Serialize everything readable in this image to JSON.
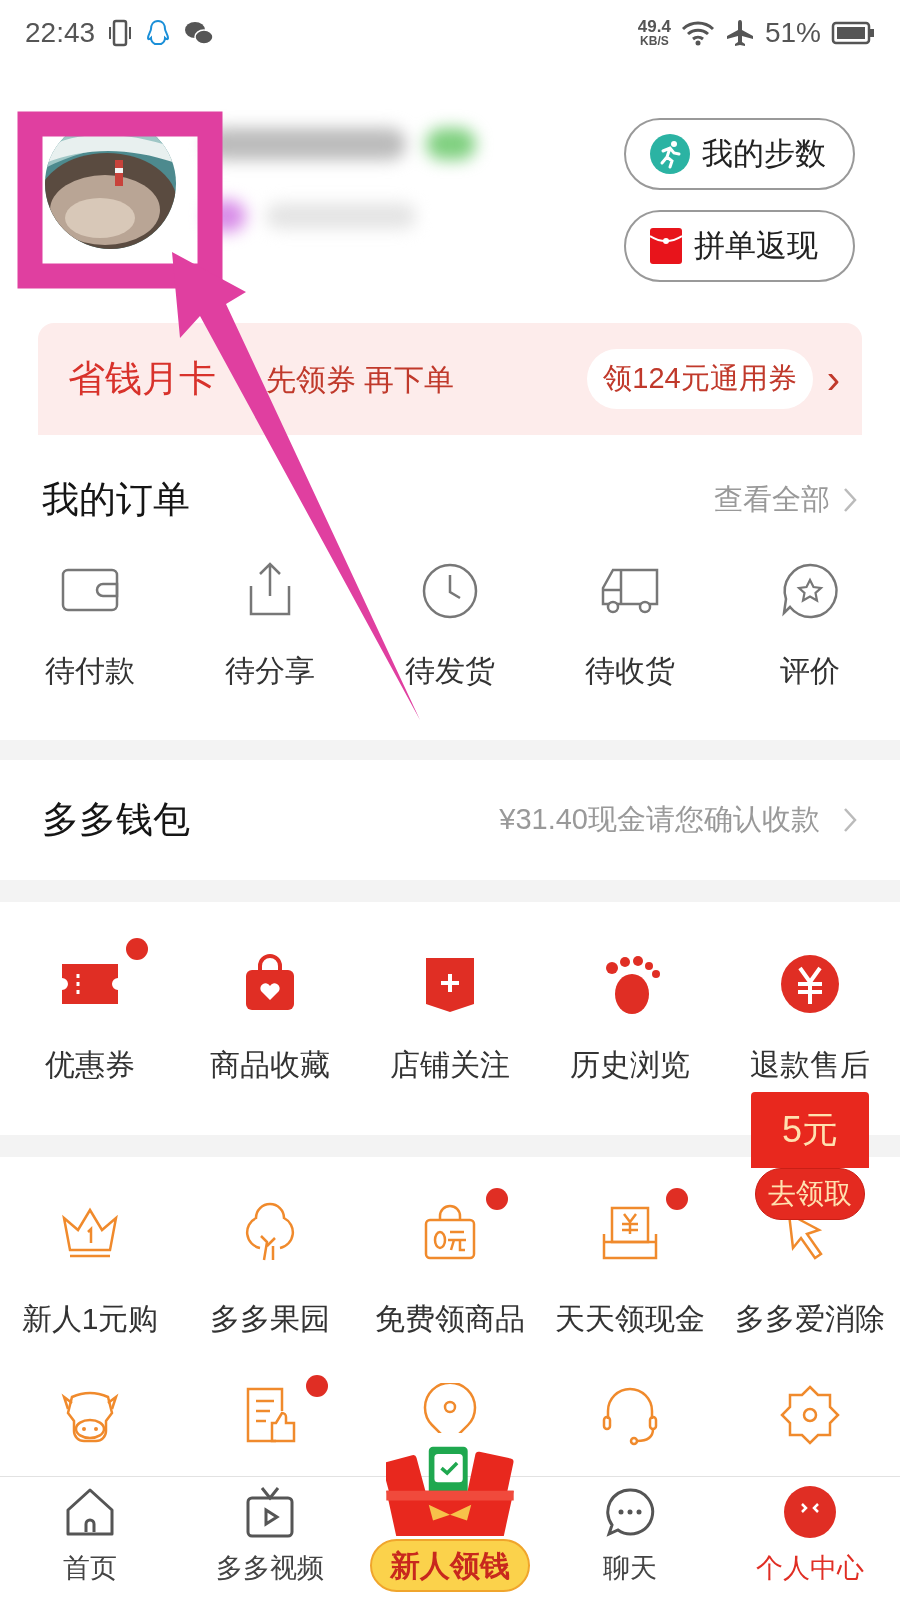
{
  "status_bar": {
    "time": "22:43",
    "net_speed": "49.4",
    "net_unit": "KB/S",
    "battery": "51%"
  },
  "profile": {
    "buttons": [
      "我的步数",
      "拼单返现"
    ]
  },
  "promo": {
    "title": "省钱月卡",
    "subtitle": "先领券 再下单",
    "offer": "领124元通用券",
    "arrow": "›"
  },
  "orders": {
    "title": "我的订单",
    "link": "查看全部",
    "items": [
      {
        "label": "待付款"
      },
      {
        "label": "待分享"
      },
      {
        "label": "待发货"
      },
      {
        "label": "待收货"
      },
      {
        "label": "评价"
      }
    ]
  },
  "wallet": {
    "title": "多多钱包",
    "info": "¥31.40现金请您确认收款"
  },
  "tools": [
    {
      "label": "优惠券",
      "dot": true
    },
    {
      "label": "商品收藏",
      "dot": false
    },
    {
      "label": "店铺关注",
      "dot": false
    },
    {
      "label": "历史浏览",
      "dot": false
    },
    {
      "label": "退款售后",
      "dot": false
    }
  ],
  "services": [
    {
      "label": "新人1元购",
      "dot": false
    },
    {
      "label": "多多果园",
      "dot": false
    },
    {
      "label": "免费领商品",
      "dot": true
    },
    {
      "label": "天天领现金",
      "dot": true
    },
    {
      "label": "多多爱消除",
      "dot": false
    }
  ],
  "services_row_2": [
    {
      "dot": false
    },
    {
      "dot": true
    },
    {
      "dot": false
    },
    {
      "dot": false
    },
    {
      "dot": false
    }
  ],
  "floating_coupon": {
    "amount": "5元",
    "action": "去领取"
  },
  "bottom_nav": [
    {
      "label": "首页",
      "selected": false
    },
    {
      "label": "多多视频",
      "selected": false
    },
    {
      "label": "新人领钱",
      "selected": false
    },
    {
      "label": "聊天",
      "selected": false
    },
    {
      "label": "个人中心",
      "selected": true
    }
  ]
}
